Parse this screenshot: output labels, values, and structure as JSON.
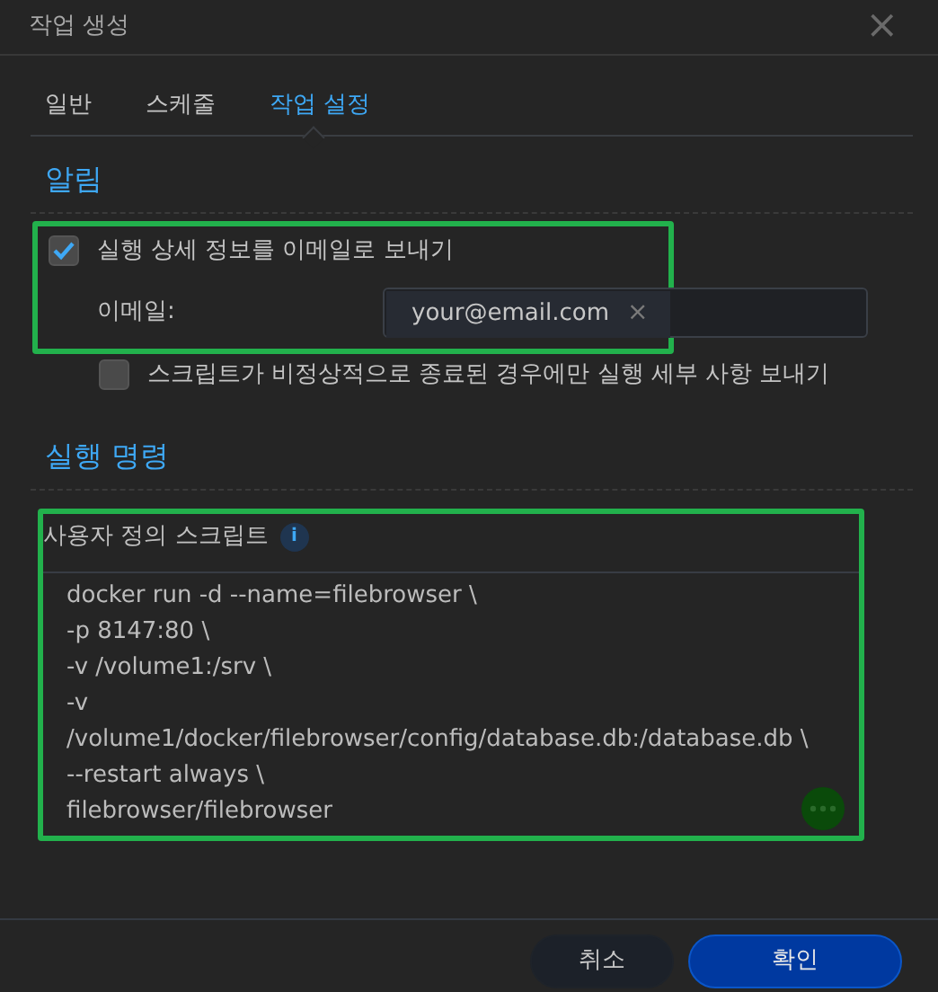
{
  "window": {
    "title": "작업 생성",
    "close": "×"
  },
  "tabs": [
    {
      "label": "일반",
      "selected": false
    },
    {
      "label": "스케줄",
      "selected": false
    },
    {
      "label": "작업 설정",
      "selected": true
    }
  ],
  "notification": {
    "heading": "알림",
    "highlighted": true,
    "send_details": {
      "label": "실행 상세 정보를 이메일로 보내기",
      "checked": true
    },
    "email": {
      "label": "이메일:",
      "tokens": [
        {
          "text": "your@email.com",
          "remove": "×"
        }
      ]
    },
    "only_on_error": {
      "label": "스크립트가 비정상적으로 종료된 경우에만 실행 세부 사항 보내기",
      "checked": false
    }
  },
  "run_command": {
    "heading": "실행 명령",
    "highlighted": true,
    "script_label": "사용자 정의 스크립트",
    "info": "i",
    "script_lines": [
      "docker run -d --name=filebrowser \\",
      "-p 8147:80 \\",
      "-v /volume1:/srv \\",
      "-v",
      "/volume1/docker/filebrowser/config/database.db:/database.db \\",
      "--restart always \\",
      "filebrowser/filebrowser"
    ]
  },
  "buttons": [
    {
      "label": "취소",
      "kind": "secondary"
    },
    {
      "label": "확인",
      "kind": "primary"
    }
  ]
}
